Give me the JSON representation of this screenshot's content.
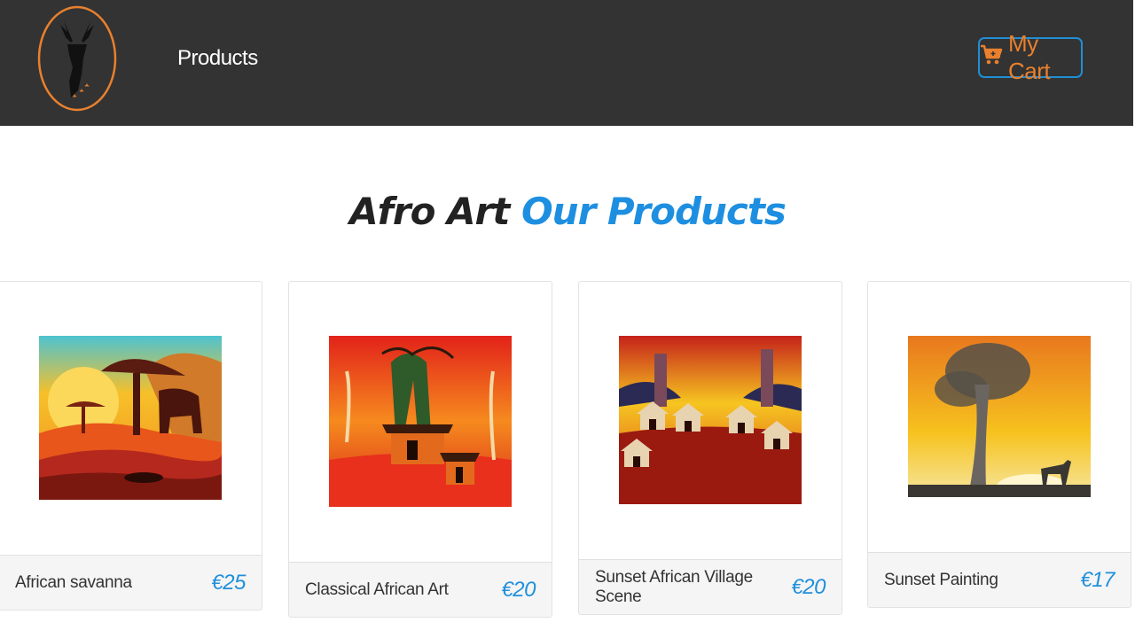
{
  "nav": {
    "products_label": "Products",
    "cart_label": "My Cart"
  },
  "colors": {
    "navbar": "#333333",
    "accent_orange": "#e9802d",
    "accent_blue": "#1e8fe0"
  },
  "heading": {
    "part1": "Afro Art",
    "part2": "Our Products"
  },
  "products": [
    {
      "title": "African savanna",
      "price": "€25",
      "icon": "savanna-painting"
    },
    {
      "title": "Classical African Art",
      "price": "€20",
      "icon": "village-painting"
    },
    {
      "title": "Sunset African Village Scene",
      "price": "€20",
      "icon": "huts-painting"
    },
    {
      "title": "Sunset Painting",
      "price": "€17",
      "icon": "sunset-painting"
    }
  ]
}
